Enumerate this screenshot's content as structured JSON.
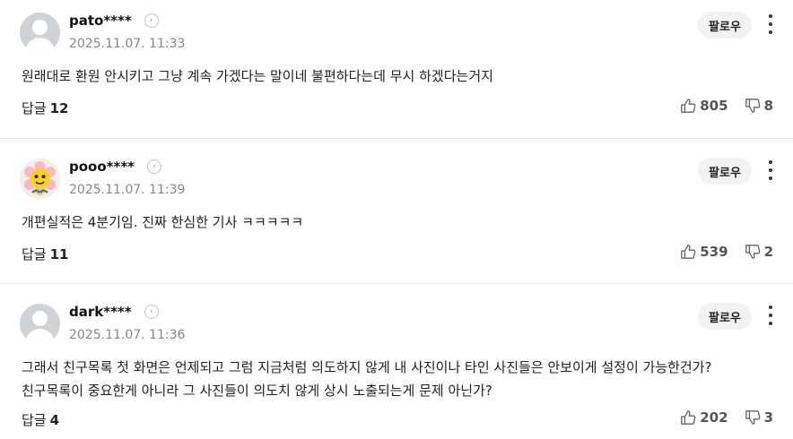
{
  "comments": [
    {
      "nickname": "pato****",
      "timestamp": "2025.11.07. 11:33",
      "follow_label": "팔로우",
      "text_lines": [
        "원래대로 환원 안시키고 그냥 계속 가겠다는 말이네 불편하다는데 무시 하겠다는거지"
      ],
      "reply_label": "답글",
      "reply_count": "12",
      "like_count": "805",
      "dislike_count": "8"
    },
    {
      "nickname": "pooo****",
      "timestamp": "2025.11.07. 11:39",
      "follow_label": "팔로우",
      "text_lines": [
        "개편실적은 4분기임. 진짜 한심한 기사 ㅋㅋㅋㅋㅋ"
      ],
      "reply_label": "답글",
      "reply_count": "11",
      "like_count": "539",
      "dislike_count": "2"
    },
    {
      "nickname": "dark****",
      "timestamp": "2025.11.07. 11:36",
      "follow_label": "팔로우",
      "text_lines": [
        "그래서 친구목록 첫 화면은 언제되고 그럼 지금처럼 의도하지 않게 내 사진이나 타인 사진들은 안보이게 설정이 가능한건가?",
        "친구목록이 중요한게 아니라 그 사진들이 의도치 않게 상시 노출되는게 문제 아닌가?"
      ],
      "reply_label": "답글",
      "reply_count": "4",
      "like_count": "202",
      "dislike_count": "3"
    }
  ]
}
